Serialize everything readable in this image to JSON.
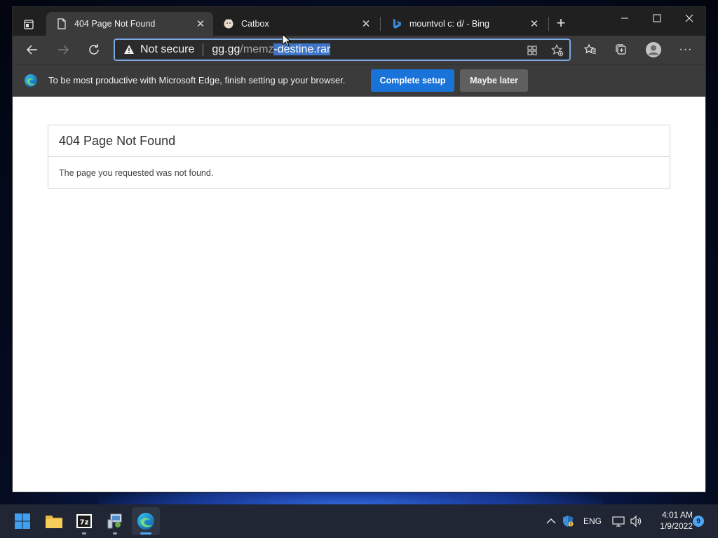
{
  "browser": {
    "tabs": [
      {
        "title": "404 Page Not Found",
        "favicon": "page-icon",
        "active": true
      },
      {
        "title": "Catbox",
        "favicon": "catbox-icon",
        "active": false
      },
      {
        "title": "mountvol c: d/ - Bing",
        "favicon": "bing-icon",
        "active": false
      }
    ],
    "address": {
      "security_label": "Not secure",
      "url_host": "gg.gg",
      "url_path_dim": "/memz",
      "url_path_selected": "-destine.rar"
    },
    "infobar": {
      "message": "To be most productive with Microsoft Edge, finish setting up your browser.",
      "primary_button": "Complete setup",
      "secondary_button": "Maybe later"
    }
  },
  "page": {
    "heading": "404 Page Not Found",
    "message": "The page you requested was not found."
  },
  "taskbar": {
    "apps": [
      "start-icon",
      "file-explorer-icon",
      "7zip-icon",
      "app-icon",
      "edge-icon"
    ],
    "language": "ENG",
    "time": "4:01 AM",
    "date": "1/9/2022",
    "notification_count": "9"
  }
}
